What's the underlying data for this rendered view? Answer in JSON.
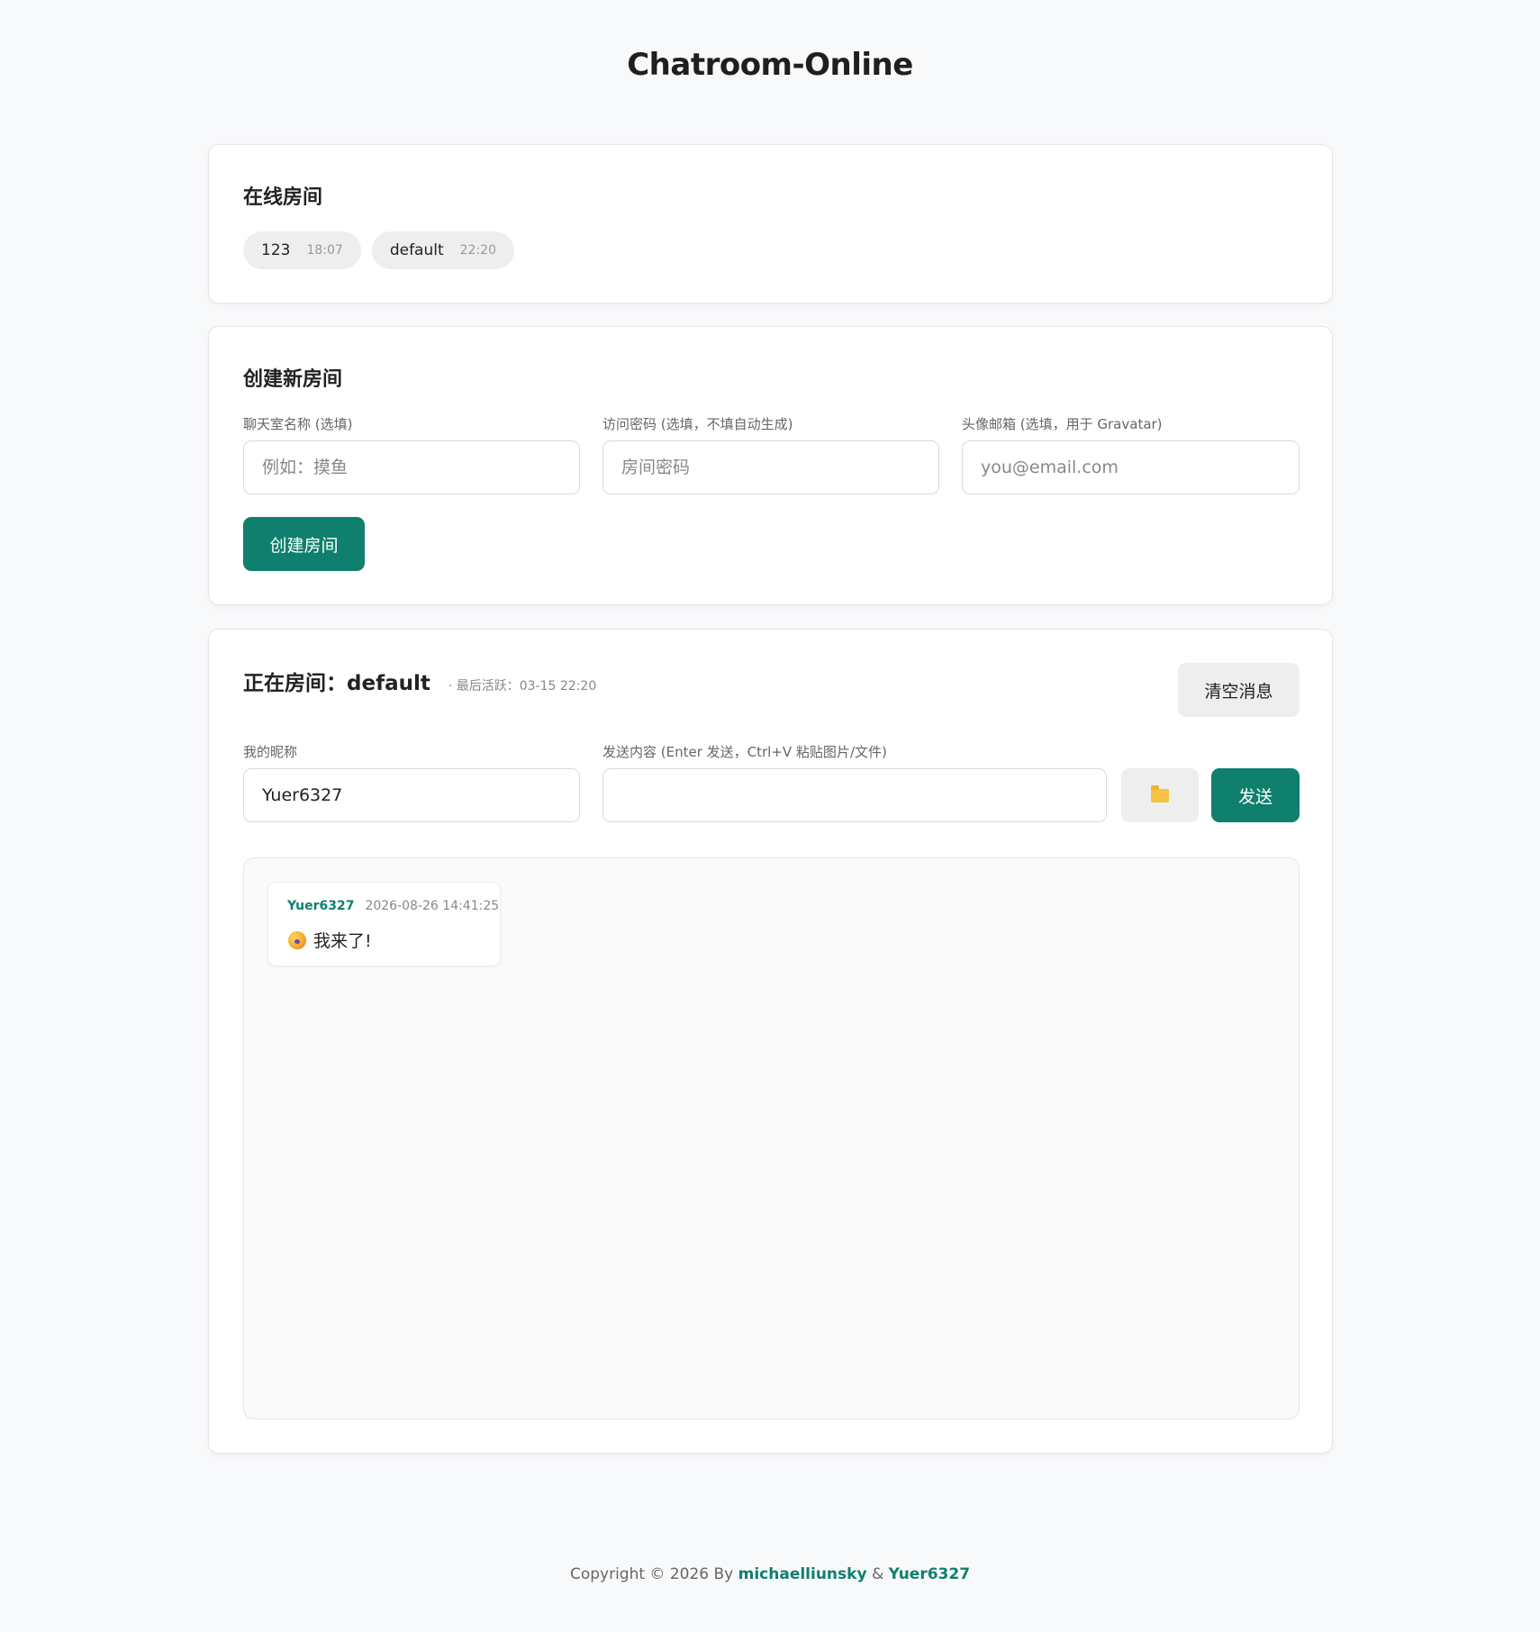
{
  "app": {
    "title": "Chatroom-Online"
  },
  "online_rooms": {
    "title": "在线房间",
    "rooms": [
      {
        "name": "123",
        "time": "18:07"
      },
      {
        "name": "default",
        "time": "22:20"
      }
    ]
  },
  "create_room": {
    "title": "创建新房间",
    "name_label": "聊天室名称 (选填)",
    "name_placeholder": "例如：摸鱼",
    "password_label": "访问密码 (选填，不填自动生成)",
    "password_placeholder": "房间密码",
    "email_label": "头像邮箱 (选填，用于 Gravatar)",
    "email_placeholder": "you@email.com",
    "create_button": "创建房间"
  },
  "current_room": {
    "prefix": "正在房间：",
    "name": "default",
    "last_active": "· 最后活跃：03-15 22:20",
    "clear_button": "清空消息",
    "nickname_label": "我的昵称",
    "nickname_value": "Yuer6327",
    "message_label": "发送内容 (Enter 发送，Ctrl+V 粘贴图片/文件)",
    "message_value": "",
    "send_button": "发送",
    "file_button_icon": "folder-icon",
    "messages": [
      {
        "user": "Yuer6327",
        "time": "2026-08-26 14:41:25",
        "icon": "party-emoji-icon",
        "text": "我来了!"
      }
    ]
  },
  "footer": {
    "prefix": "Copyright © 2026 By ",
    "author1": "michaelliunsky",
    "separator": " & ",
    "author2": "Yuer6327"
  },
  "colors": {
    "accent": "#0f7f6e",
    "background": "#f8f9fa"
  }
}
